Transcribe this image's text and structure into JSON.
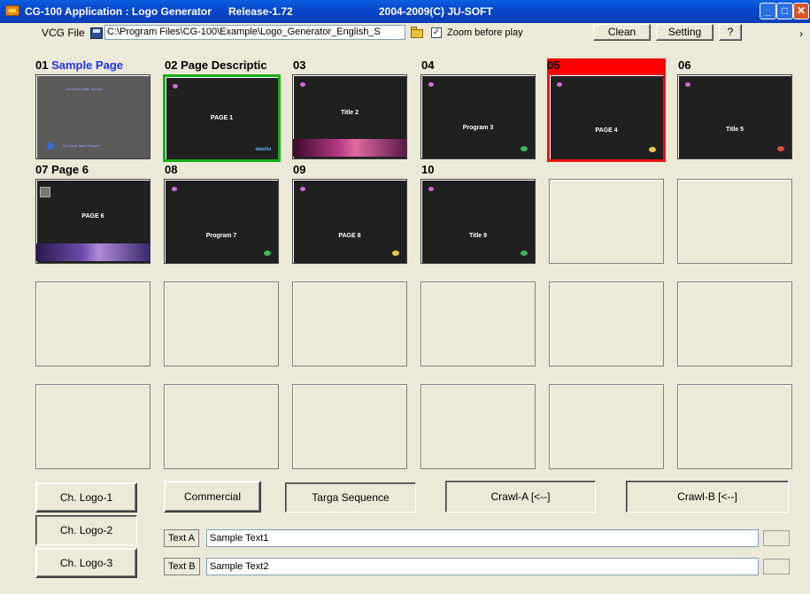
{
  "titlebar": {
    "app_title": "CG-100 Application : Logo Generator",
    "release": "Release-1.72",
    "copyright": "2004-2009(C) JU-SOFT"
  },
  "toolbar": {
    "vcg_label": "VCG File",
    "path_value": "C:\\Program Files\\CG-100\\Example\\Logo_Generator_English_S",
    "zoom_label": "Zoom before play",
    "zoom_checked": true,
    "clean_label": "Clean",
    "setting_label": "Setting",
    "help_label": "?",
    "more_label": "›"
  },
  "pages": [
    {
      "num": "01",
      "name": "Sample Page",
      "title": "",
      "style": "gray"
    },
    {
      "num": "02",
      "name": "Page Descriptic",
      "title": "PAGE 1",
      "style": "green"
    },
    {
      "num": "03",
      "name": "",
      "title": "Title 2",
      "style": "band"
    },
    {
      "num": "04",
      "name": "",
      "title": "Program 3",
      "style": "plain"
    },
    {
      "num": "05",
      "name": "",
      "title": "PAGE 4",
      "style": "red"
    },
    {
      "num": "06",
      "name": "",
      "title": "Title 5",
      "style": "plain"
    },
    {
      "num": "07",
      "name": "Page 6",
      "title": "PAGE 6",
      "style": "purple"
    },
    {
      "num": "08",
      "name": "",
      "title": "Program 7",
      "style": "plain"
    },
    {
      "num": "09",
      "name": "",
      "title": "PAGE 8",
      "style": "plain"
    },
    {
      "num": "10",
      "name": "",
      "title": "Title 9",
      "style": "plain"
    }
  ],
  "thumbnail_small_text": {
    "top": "EN Sand State Sample",
    "bottom": "KO Sand State Sample",
    "logo": "dataVel"
  },
  "buttons": {
    "ch_logo_1": "Ch. Logo-1",
    "ch_logo_2": "Ch. Logo-2",
    "ch_logo_3": "Ch. Logo-3",
    "commercial": "Commercial",
    "targa_sequence": "Targa Sequence",
    "crawl_a": "Crawl-A  [<--]",
    "crawl_b": "Crawl-B  [<--]"
  },
  "text_inputs": {
    "a_label": "Text A",
    "a_value": "Sample Text1",
    "b_label": "Text B",
    "b_value": "Sample Text2"
  },
  "colors": {
    "titlebar": "#0843c8",
    "selected_green": "#12b012",
    "selected_red": "#ee1111",
    "page_name_blue": "#2233ee"
  }
}
